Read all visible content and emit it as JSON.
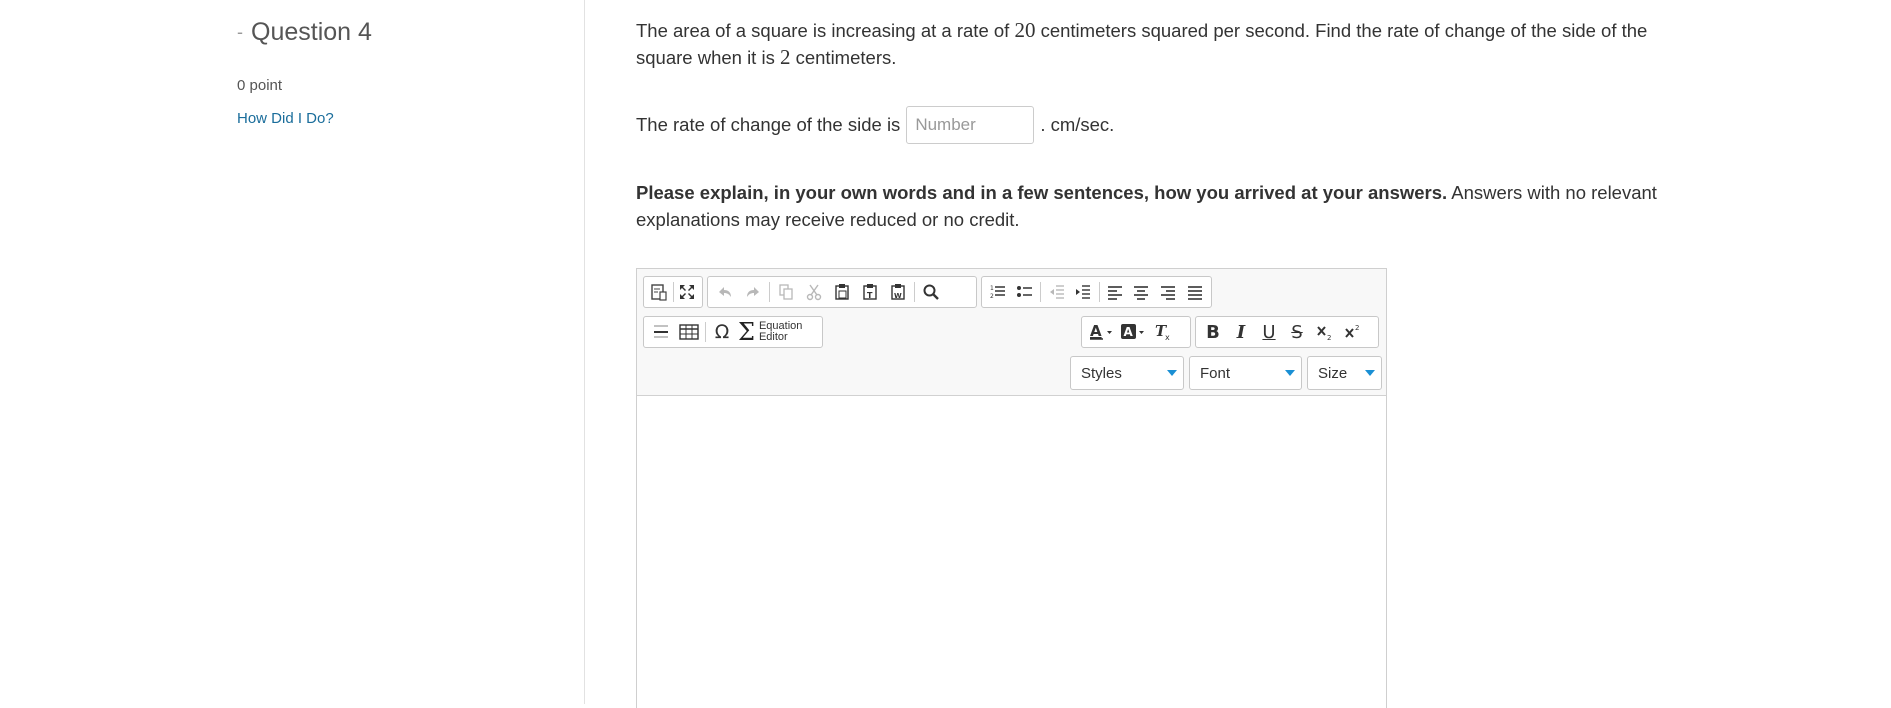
{
  "sidebar": {
    "toggle": "-",
    "question_title": "Question 4",
    "points": "0 point",
    "how_link": "How Did I Do?"
  },
  "question": {
    "stem_part1": "The area of a square is increasing at a rate of ",
    "rate_value": "20",
    "stem_part2": " centimeters squared per second. Find the rate of change of the side of the square when it is ",
    "side_value": "2",
    "stem_part3": " centimeters.",
    "answer_prefix": "The rate of change of the side is",
    "answer_placeholder": "Number",
    "answer_value": "",
    "answer_suffix": ". cm/sec.",
    "explain_bold": "Please explain, in your own words and in a few sentences, how you arrived at your answers.",
    "explain_rest": " Answers with no relevant explanations may receive reduced or no credit."
  },
  "editor": {
    "toolbar_icons_row1": [
      "source-icon",
      "maximize-icon",
      "undo-icon",
      "redo-icon",
      "copy-icon",
      "cut-icon",
      "paste-icon",
      "paste-text-icon",
      "paste-word-icon",
      "find-icon",
      "numbered-list-icon",
      "bulleted-list-icon",
      "decrease-indent-icon",
      "increase-indent-icon",
      "align-left-icon",
      "align-center-icon",
      "align-right-icon",
      "justify-icon"
    ],
    "equation_editor_line1": "Equation",
    "equation_editor_line2": "Editor",
    "styles_label": "Styles",
    "font_label": "Font",
    "size_label": "Size",
    "bold_label": "B",
    "italic_label": "I",
    "underline_label": "U",
    "strike_label": "S",
    "omega_label": "Ω",
    "sigma_label": "Σ"
  }
}
